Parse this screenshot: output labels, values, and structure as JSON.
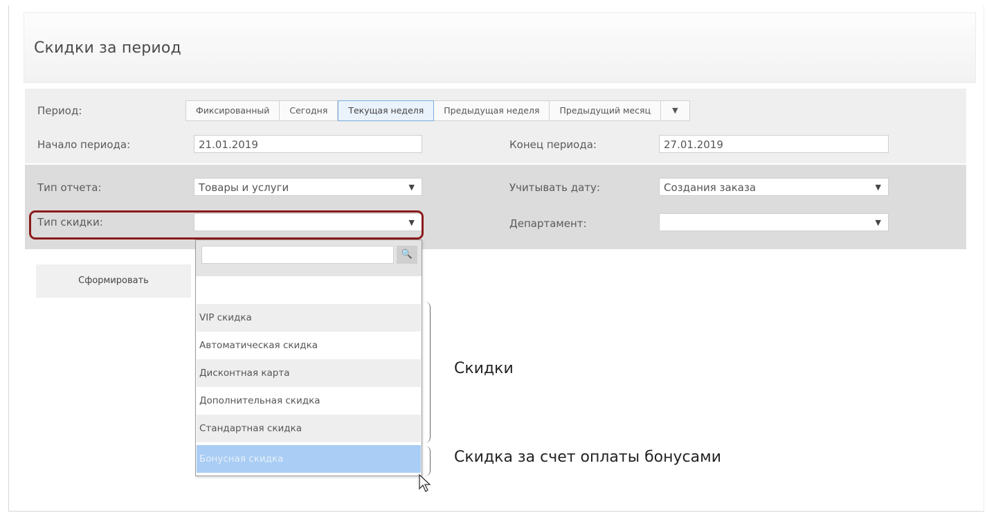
{
  "page": {
    "title": "Скидки за период"
  },
  "period": {
    "label": "Период:",
    "tabs": [
      "Фиксированный",
      "Сегодня",
      "Текущая неделя",
      "Предыдущая неделя",
      "Предыдущий месяц"
    ],
    "active_tab": "Текущая неделя",
    "more_icon": "caret-down-icon"
  },
  "start": {
    "label": "Начало периода:",
    "value": "21.01.2019"
  },
  "end": {
    "label": "Конец периода:",
    "value": "27.01.2019"
  },
  "report_type": {
    "label": "Тип отчета:",
    "value": "Товары и услуги"
  },
  "count_date": {
    "label": "Учитывать дату:",
    "value": "Создания заказа"
  },
  "discount_type": {
    "label": "Тип скидки:",
    "value": "",
    "options": [
      "VIP скидка",
      "Автоматическая скидка",
      "Дисконтная карта",
      "Дополнительная скидка",
      "Стандартная скидка",
      "Бонусная скидка"
    ],
    "selected_index": 5
  },
  "department": {
    "label": "Департамент:",
    "value": ""
  },
  "actions": {
    "build_label": "Сформировать"
  },
  "annotations": {
    "discounts": "Скидки",
    "bonus": "Скидка за счет оплаты бонусами"
  },
  "colors": {
    "highlight": "#8b1a1a",
    "selected_option": "#a9cdf4",
    "active_tab_border": "#7aaede"
  }
}
